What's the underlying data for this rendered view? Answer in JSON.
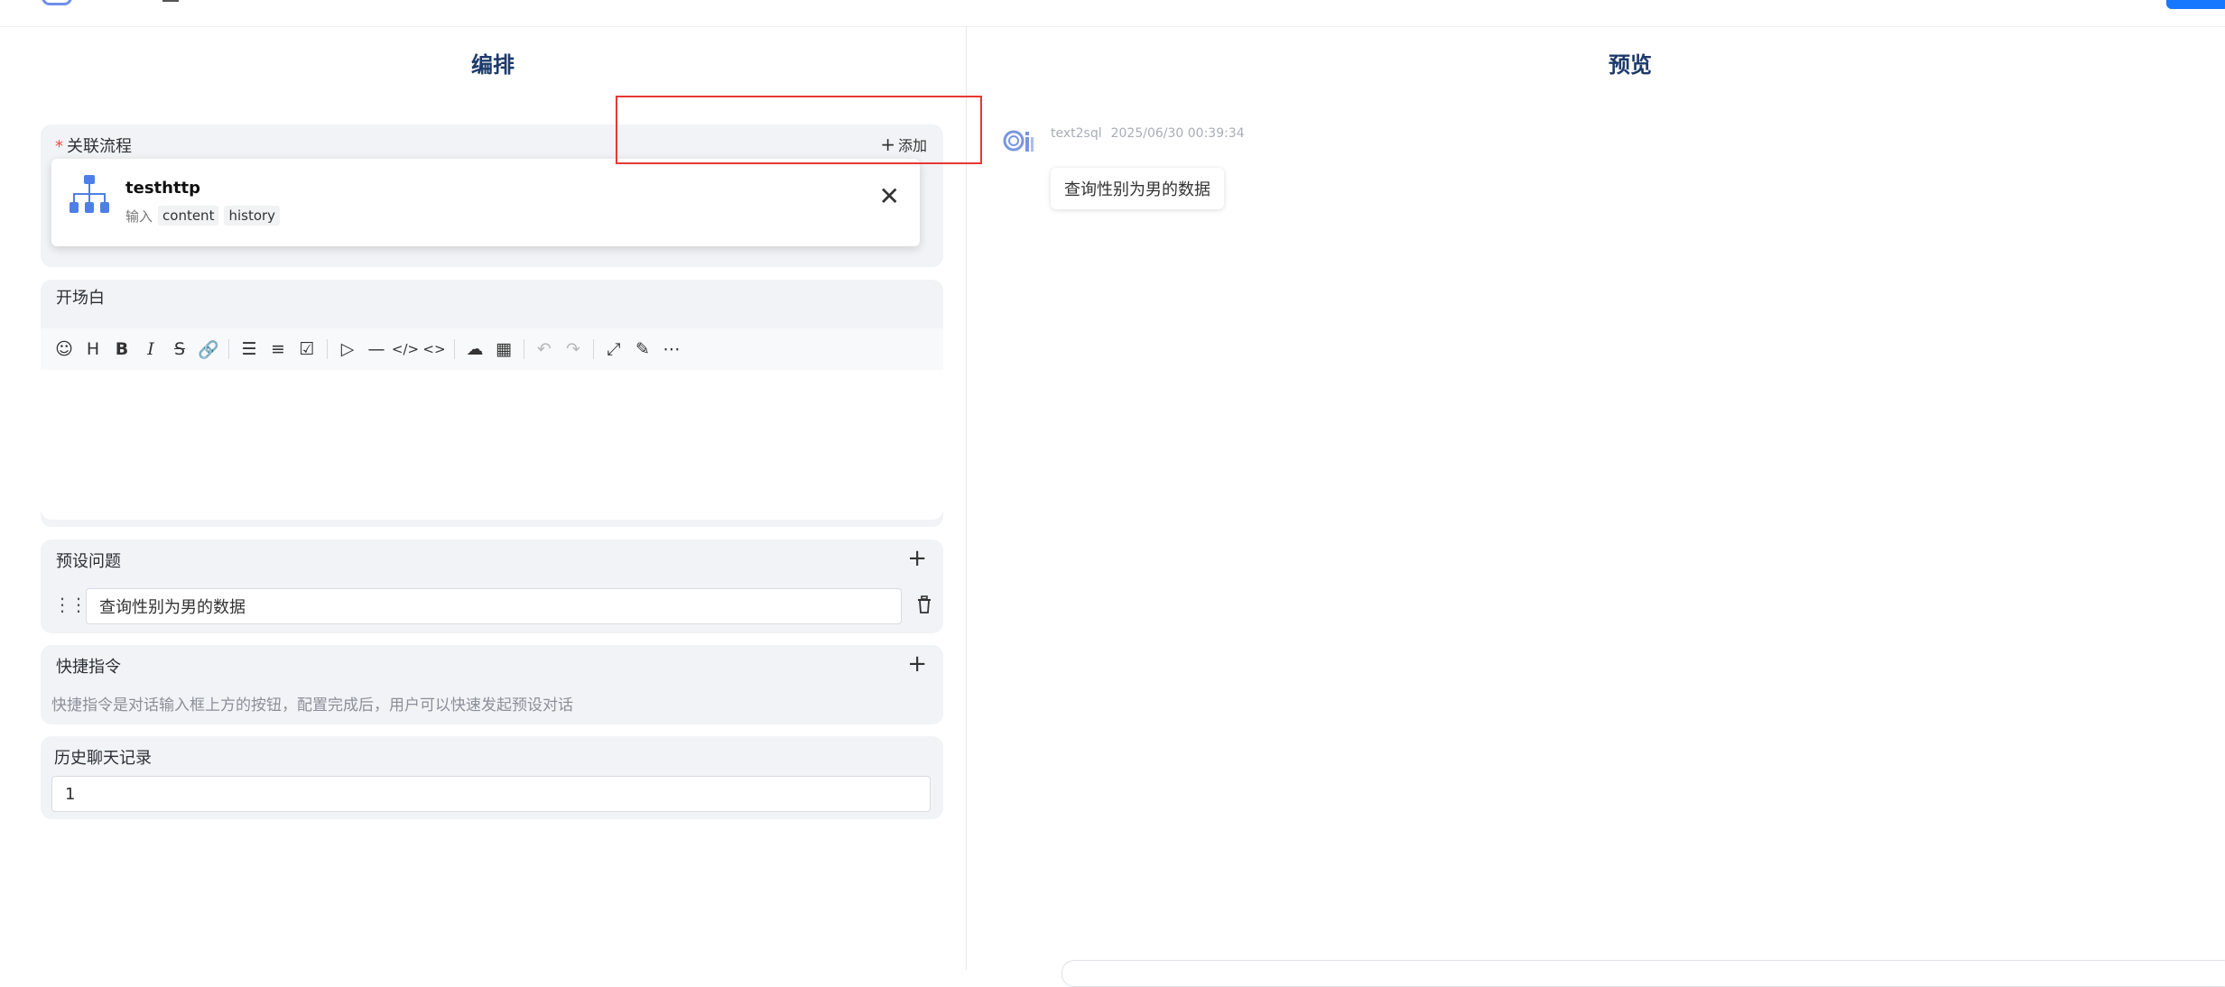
{
  "panels": {
    "left_title": "编排",
    "right_title": "预览"
  },
  "related_flow": {
    "required_mark": "*",
    "label": "关联流程",
    "add_label": "添加",
    "flow": {
      "name": "testhttp",
      "input_label": "输入",
      "inputs": [
        "content",
        "history"
      ]
    }
  },
  "opening": {
    "label": "开场白",
    "toolbar_icons": [
      "emoji-icon",
      "heading-icon",
      "bold-icon",
      "italic-icon",
      "strikethrough-icon",
      "link-icon",
      "bullet-list-icon",
      "ordered-list-icon",
      "checklist-icon",
      "quote-icon",
      "horizontal-rule-icon",
      "code-icon",
      "inline-code-icon",
      "upload-icon",
      "table-icon",
      "undo-icon",
      "redo-icon",
      "fullscreen-icon",
      "edit-icon",
      "more-icon"
    ]
  },
  "preset_questions": {
    "label": "预设问题",
    "items": [
      "查询性别为男的数据"
    ]
  },
  "shortcuts": {
    "label": "快捷指令",
    "hint": "快捷指令是对话输入框上方的按钮，配置完成后，用户可以快速发起预设对话"
  },
  "history": {
    "label": "历史聊天记录",
    "value": "1"
  },
  "preview": {
    "bot_name": "text2sql",
    "timestamp": "2025/06/30 00:39:34",
    "message": "查询性别为男的数据"
  },
  "colors": {
    "accent": "#1677ff",
    "title": "#1d3a6b",
    "highlight": "#e53935",
    "required": "#ee4c4c"
  }
}
